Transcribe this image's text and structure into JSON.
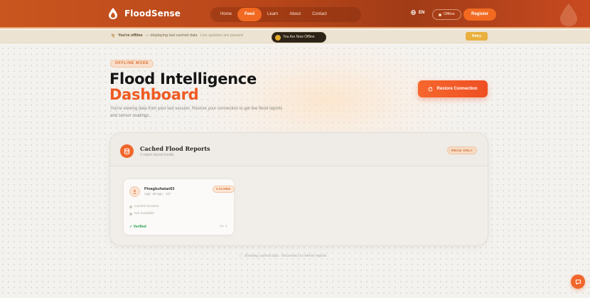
{
  "header": {
    "brand": "FloodSense",
    "nav": [
      {
        "label": "Home",
        "active": false
      },
      {
        "label": "Feed",
        "active": true
      },
      {
        "label": "Learn",
        "active": false
      },
      {
        "label": "About",
        "active": false
      },
      {
        "label": "Contact",
        "active": false
      }
    ],
    "language": "EN",
    "status": "Offline",
    "register_label": "Register"
  },
  "banner": {
    "heading": "You're offline",
    "message": "— displaying last cached data",
    "note": "Live updates are paused",
    "chip": "You Are Now Offline",
    "retry_label": "Retry"
  },
  "hero": {
    "mode_chip": "OFFLINE MODE",
    "title_line1": "Flood Intelligence",
    "title_line2": "Dashboard",
    "subtitle": "You're viewing data from your last session. Restore your connection to get live flood reports and sensor readings.",
    "restore_label": "Restore Connection"
  },
  "reports": {
    "title": "Cached Flood Reports",
    "subtitle": "1 report stored locally",
    "badge": "READ ONLY",
    "items": [
      {
        "user": "Pinagbuhatan63",
        "time": "Age: 3d ago · 1/2",
        "badge": "CACHED",
        "location": "Cached location",
        "meta": "Not available",
        "status": "Verified",
        "count": "no. 1"
      }
    ]
  },
  "footer_note": "Showing cached data · Reconnect to refresh reports"
}
